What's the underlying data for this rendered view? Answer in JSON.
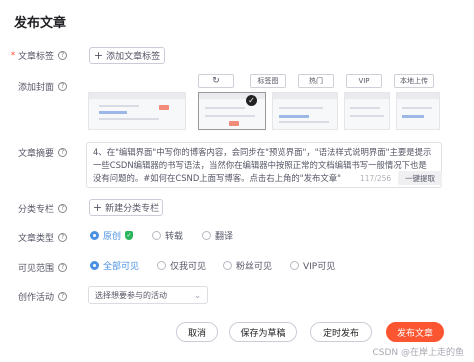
{
  "dialog": {
    "title": "发布文章"
  },
  "tags": {
    "label": "文章标签",
    "required_mark": "*",
    "add_button": "添加文章标签"
  },
  "cover": {
    "label": "添加封面",
    "refresh_icon": "refresh-icon",
    "options": [
      "标签图",
      "热门",
      "VIP",
      "本地上传"
    ]
  },
  "summary": {
    "label": "文章摘要",
    "text": "4、在\"编辑界面\"中写你的博客内容，会同步在\"预览界面\"，\"语法样式说明界面\"主要是提示一些CSDN编辑器的书写语法，当然你在编辑器中按照正常的文档编辑书写一般情况下也是没有问题的。#如何在CSND上面写博客。点击右上角的\"发布文章\"",
    "count": "117/256",
    "extract_button": "一键提取"
  },
  "column": {
    "label": "分类专栏",
    "add_button": "新建分类专栏"
  },
  "article_type": {
    "label": "文章类型",
    "options": [
      {
        "label": "原创",
        "selected": true
      },
      {
        "label": "转载",
        "selected": false
      },
      {
        "label": "翻译",
        "selected": false
      }
    ]
  },
  "visibility": {
    "label": "可见范围",
    "options": [
      {
        "label": "全部可见",
        "selected": true
      },
      {
        "label": "仅我可见",
        "selected": false
      },
      {
        "label": "粉丝可见",
        "selected": false
      },
      {
        "label": "VIP可见",
        "selected": false
      }
    ]
  },
  "activity": {
    "label": "创作活动",
    "placeholder": "选择想要参与的活动"
  },
  "footer": {
    "cancel": "取消",
    "save_draft": "保存为草稿",
    "schedule": "定时发布",
    "publish": "发布文章"
  },
  "watermark": "CSDN @在岸上走的鱼",
  "colors": {
    "accent": "#fc5531",
    "radio_selected": "#4a90e2",
    "badge_green": "#2db55d"
  }
}
